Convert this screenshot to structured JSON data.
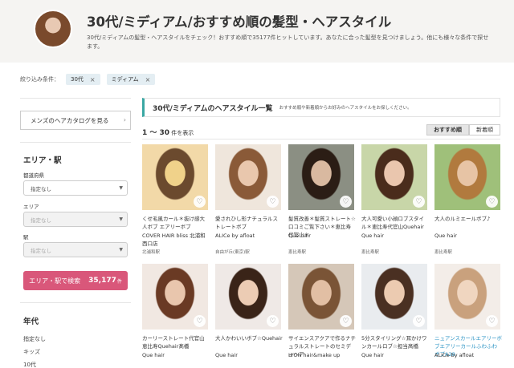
{
  "header": {
    "title": "30代/ミディアム/おすすめ順の髪型・ヘアスタイル",
    "description": "30代/ミディアムの髪型・ヘアスタイルをチェック！おすすめ順で35177件ヒットしています。あなたに合った髪型を見つけましょう。他にも様々な条件で探せます。"
  },
  "filters": {
    "label": "絞り込み条件：",
    "chips": [
      {
        "label": "30代"
      },
      {
        "label": "ミディアム"
      }
    ],
    "remove_glyph": "×"
  },
  "sidebar": {
    "catalog_link": "メンズのヘアカタログを見る",
    "section_title": "エリア・駅",
    "prefecture_label": "都道府県",
    "prefecture_value": "指定なし",
    "area_label": "エリア",
    "area_value": "指定なし",
    "station_label": "駅",
    "station_value": "指定なし",
    "search_label": "エリア・駅で検索",
    "search_count": "35,177",
    "search_unit": "件",
    "age_title": "年代",
    "age_items": [
      "指定なし",
      "キッズ",
      "10代"
    ]
  },
  "main": {
    "list_title": "30代/ミディアムのヘアスタイル一覧",
    "list_subtitle": "おすすめ順や新着順からお好みのヘアスタイルをお探しください。",
    "range": "1 ～ 30",
    "range_suffix": "件を表示",
    "sort_options": [
      "おすすめ順",
      "新着順"
    ],
    "heart_glyph": "♡"
  },
  "styles": [
    {
      "title": "くせ毛風カール＊抜け感大人ボブ エアリーボブ",
      "salon": "COVER HAIR bliss 北浦和西口店",
      "station": "北浦和駅"
    },
    {
      "title": "愛されひし形ナチュラルストレートボブ",
      "salon": "ALICe by afloat",
      "station": "自由が丘(東京)駅"
    },
    {
      "title": "髪質改善＊髪質ストレート☆口コミご覧下さい＊恵比寿代官山＊",
      "salon": "Que hair",
      "station": "恵比寿駅"
    },
    {
      "title": "大人可愛い小顔ロブスタイル＊恵比寿代官山Quehair",
      "salon": "Que hair",
      "station": "恵比寿駅"
    },
    {
      "title": "大人のルミエールボブ♪",
      "salon": "Que hair",
      "station": "恵比寿駅"
    },
    {
      "title": "カーリーストレート代官山恵比寿Quehair髙橋",
      "salon": "Que hair",
      "station": "恵比寿駅"
    },
    {
      "title": "大人かわいいボブ☆Quehair",
      "salon": "Que hair",
      "station": "恵比寿駅"
    },
    {
      "title": "サイエンスアクアで作るナチュラルストレートのセミディヘア",
      "salon": "LYON hair&make up",
      "station": ""
    },
    {
      "title": "5分スタイリング☆耳かけワンカールロブ☆担当髙橋",
      "salon": "Que hair",
      "station": "恵比寿駅"
    },
    {
      "title": "ニュアンスカールエアリーボブエアリーカールふわふわボブA28",
      "salon": "ALICe by afloat",
      "station": ""
    }
  ],
  "colors": {
    "accent_pink": "#d9577a",
    "accent_teal": "#3aa7a3",
    "link_blue": "#2a93c4",
    "hero_bg": "#f5f4f2"
  }
}
